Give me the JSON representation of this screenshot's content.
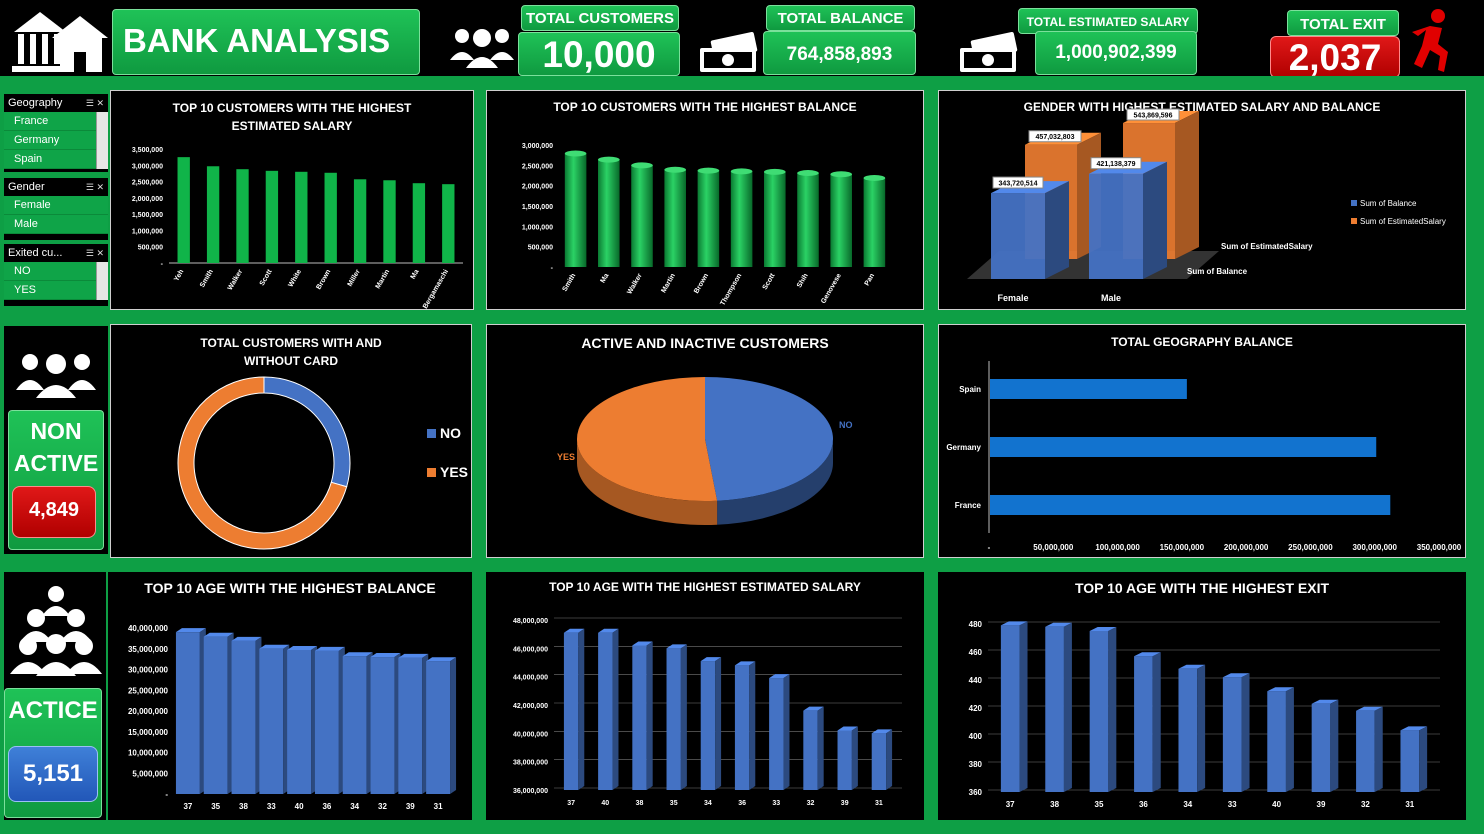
{
  "header": {
    "title": "BANK ANALYSIS",
    "kpis": [
      {
        "label": "TOTAL CUSTOMERS",
        "value": "10,000"
      },
      {
        "label": "TOTAL BALANCE",
        "value": "764,858,893"
      },
      {
        "label": "TOTAL ESTIMATED SALARY",
        "value": "1,000,902,399"
      },
      {
        "label": "TOTAL EXIT",
        "value": "2,037"
      }
    ]
  },
  "slicers": [
    {
      "title": "Geography",
      "items": [
        "France",
        "Germany",
        "Spain"
      ]
    },
    {
      "title": "Gender",
      "items": [
        "Female",
        "Male"
      ]
    },
    {
      "title": "Exited cu...",
      "items": [
        "NO",
        "YES"
      ]
    }
  ],
  "side": {
    "non_active_label": "NON ACTIVE",
    "non_active_value": "4,849",
    "active_label": "ACTICE",
    "active_value": "5,151"
  },
  "colors": {
    "green": "#0e9f45",
    "blue": "#4472c4",
    "orange": "#ed7d31",
    "red": "#d10000"
  },
  "chart_data": [
    {
      "id": "c1",
      "type": "bar",
      "title": "TOP 10 CUSTOMERS WITH THE HIGHEST ESTIMATED SALARY",
      "categories": [
        "Yeh",
        "Smith",
        "Walker",
        "Scott",
        "White",
        "Brown",
        "Miller",
        "Martin",
        "Ma",
        "Bergamaschi"
      ],
      "values": [
        3250000,
        2970000,
        2880000,
        2830000,
        2800000,
        2770000,
        2570000,
        2540000,
        2450000,
        2420000
      ],
      "ylim": [
        0,
        3500000
      ],
      "yticks": [
        "-",
        "500,000",
        "1,000,000",
        "1,500,000",
        "2,000,000",
        "2,500,000",
        "3,000,000",
        "3,500,000"
      ]
    },
    {
      "id": "c2",
      "type": "bar",
      "title": "TOP 1O CUSTOMERS WITH THE HIGHEST BALANCE",
      "categories": [
        "Smith",
        "Ma",
        "Walker",
        "Martin",
        "Brown",
        "Thompson",
        "Scott",
        "Shih",
        "Genovese",
        "Pan"
      ],
      "values": [
        2790000,
        2640000,
        2500000,
        2390000,
        2370000,
        2350000,
        2340000,
        2310000,
        2280000,
        2190000
      ],
      "ylim": [
        0,
        3000000
      ],
      "yticks": [
        "-",
        "500,000",
        "1,000,000",
        "1,500,000",
        "2,000,000",
        "2,500,000",
        "3,000,000"
      ]
    },
    {
      "id": "c3",
      "type": "bar",
      "title": "GENDER WITH HIGHEST ESTIMATED SALARY AND BALANCE",
      "categories": [
        "Female",
        "Male"
      ],
      "series": [
        {
          "name": "Sum of Balance",
          "values": [
            343720514,
            421138379
          ]
        },
        {
          "name": "Sum of EstimatedSalary",
          "values": [
            457032803,
            543869596
          ]
        }
      ],
      "labels": [
        "343,720,514",
        "421,138,379",
        "457,032,803",
        "543,869,596"
      ]
    },
    {
      "id": "c4",
      "type": "pie",
      "title": "TOTAL CUSTOMERS WITH AND WITHOUT CARD",
      "categories": [
        "NO",
        "YES"
      ],
      "values": [
        2945,
        7055
      ]
    },
    {
      "id": "c5",
      "type": "pie",
      "title": "ACTIVE AND INACTIVE CUSTOMERS",
      "categories": [
        "NO",
        "YES"
      ],
      "values": [
        4849,
        5151
      ]
    },
    {
      "id": "c6",
      "type": "bar",
      "title": "TOTAL GEOGRAPHY BALANCE",
      "categories": [
        "Spain",
        "Germany",
        "France"
      ],
      "values": [
        153123552,
        300402861,
        311332480
      ],
      "xlim": [
        0,
        350000000
      ],
      "xticks": [
        "-",
        "50,000,000",
        "100,000,000",
        "150,000,000",
        "200,000,000",
        "250,000,000",
        "300,000,000",
        "350,000,000"
      ]
    },
    {
      "id": "c7",
      "type": "bar",
      "title": "TOP 10 AGE WITH THE HIGHEST BALANCE",
      "categories": [
        "37",
        "35",
        "38",
        "33",
        "40",
        "36",
        "34",
        "32",
        "39",
        "31"
      ],
      "values": [
        39000000,
        37900000,
        36900000,
        35000000,
        34700000,
        34500000,
        33200000,
        33000000,
        32800000,
        32000000
      ],
      "ylim": [
        0,
        40000000
      ],
      "yticks": [
        "-",
        "5,000,000",
        "10,000,000",
        "15,000,000",
        "20,000,000",
        "25,000,000",
        "30,000,000",
        "35,000,000",
        "40,000,000"
      ]
    },
    {
      "id": "c8",
      "type": "bar",
      "title": "TOP 10 AGE WITH THE HIGHEST ESTIMATED SALARY",
      "categories": [
        "37",
        "40",
        "38",
        "35",
        "34",
        "36",
        "33",
        "32",
        "39",
        "31"
      ],
      "values": [
        47100000,
        47100000,
        46200000,
        46000000,
        45100000,
        44800000,
        43900000,
        41600000,
        40200000,
        40000000
      ],
      "ylim": [
        36000000,
        48000000
      ],
      "yticks": [
        "36,000,000",
        "38,000,000",
        "40,000,000",
        "42,000,000",
        "44,000,000",
        "46,000,000",
        "48,000,000"
      ]
    },
    {
      "id": "c9",
      "type": "bar",
      "title": "TOP 10 AGE WITH THE HIGHEST EXIT",
      "categories": [
        "37",
        "38",
        "35",
        "36",
        "34",
        "33",
        "40",
        "39",
        "32",
        "31"
      ],
      "values": [
        479,
        478,
        475,
        457,
        448,
        442,
        432,
        423,
        418,
        404
      ],
      "ylim": [
        360,
        480
      ],
      "yticks": [
        "360",
        "380",
        "400",
        "420",
        "440",
        "460",
        "480"
      ]
    }
  ]
}
